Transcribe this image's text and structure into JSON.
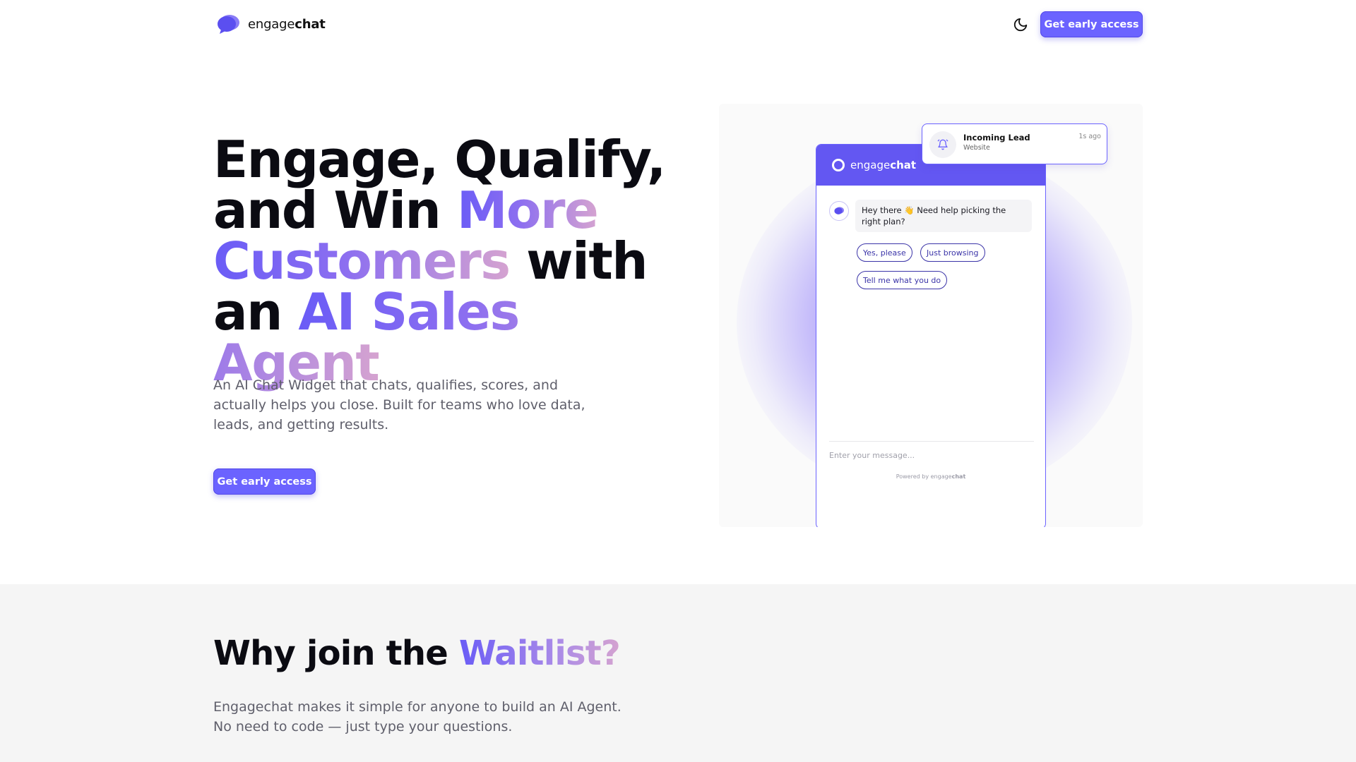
{
  "nav": {
    "brand_prefix": "engage",
    "brand_suffix": "chat",
    "cta_label": "Get early access"
  },
  "hero": {
    "title_line1": "Engage, Qualify,",
    "title_line2_plain": "and Win ",
    "title_line2_grad": "More",
    "title_line3_grad": "Customers",
    "title_line3_plain": " with",
    "title_line4_plain": "an ",
    "title_line4_grad": "AI Sales Agent",
    "subtitle": "An AI Chat Widget that chats, qualifies, scores, and actually helps you close. Built for teams who love data, leads, and getting results.",
    "cta_label": "Get early access"
  },
  "widget": {
    "brand_prefix": "engage",
    "brand_suffix": "chat",
    "bot_message": "Hey there 👋 Need help picking the right plan?",
    "chips": [
      "Yes, please",
      "Just browsing",
      "Tell me what you do"
    ],
    "input_placeholder": "Enter your message...",
    "powered_prefix": "Powered by ",
    "powered_brand_a": "engage",
    "powered_brand_b": "chat"
  },
  "lead_card": {
    "title": "Incoming Lead",
    "source": "Website",
    "time": "1s ago"
  },
  "waitlist": {
    "title_plain": "Why join the ",
    "title_grad": "Waitlist?",
    "subtitle_line1": "Engagechat makes it simple for anyone to build an AI Agent.",
    "subtitle_line2": "No need to code — just type your questions."
  },
  "colors": {
    "accent": "#6b63ff",
    "accent_dark": "#6357f2",
    "gradient_start": "#6a5cf6",
    "gradient_end": "#d5a3d0",
    "muted_text": "#5f5f6b"
  }
}
